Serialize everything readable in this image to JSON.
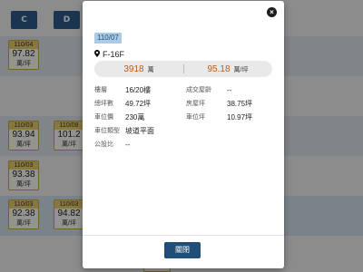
{
  "grid": {
    "columns": [
      "C",
      "D"
    ],
    "cells": [
      {
        "date": "110/04",
        "price": "97.82",
        "unit": "萬/坪"
      },
      {
        "date": "110/03",
        "price": "93.94",
        "unit": "萬/坪"
      },
      {
        "date": "110/08",
        "price": "101.2",
        "unit": "萬/坪"
      },
      {
        "date": "110/03",
        "price": "93.38",
        "unit": "萬/坪"
      },
      {
        "date": "110/03",
        "price": "92.38",
        "unit": "萬/坪"
      },
      {
        "date": "110/03",
        "price": "94.82",
        "unit": "萬/坪"
      }
    ],
    "tail_unit": "萬/坪"
  },
  "modal": {
    "date": "110/07",
    "floor": "F-16F",
    "total_price": "3918",
    "total_unit": "萬",
    "unit_price": "95.18",
    "unit_price_unit": "萬/坪",
    "details": [
      {
        "label": "樓層",
        "value": "16/20樓",
        "label2": "成交屋齡",
        "value2": "--"
      },
      {
        "label": "總坪數",
        "value": "49.72坪",
        "label2": "房屋坪",
        "value2": "38.75坪"
      },
      {
        "label": "車位價",
        "value": "230萬",
        "label2": "車位坪",
        "value2": "10.97坪"
      },
      {
        "label": "車位類型",
        "value": "坡道平面",
        "label2": "",
        "value2": ""
      },
      {
        "label": "公設比",
        "value": "--",
        "label2": "",
        "value2": ""
      }
    ],
    "close_label": "×",
    "ok_label": "關閉"
  }
}
